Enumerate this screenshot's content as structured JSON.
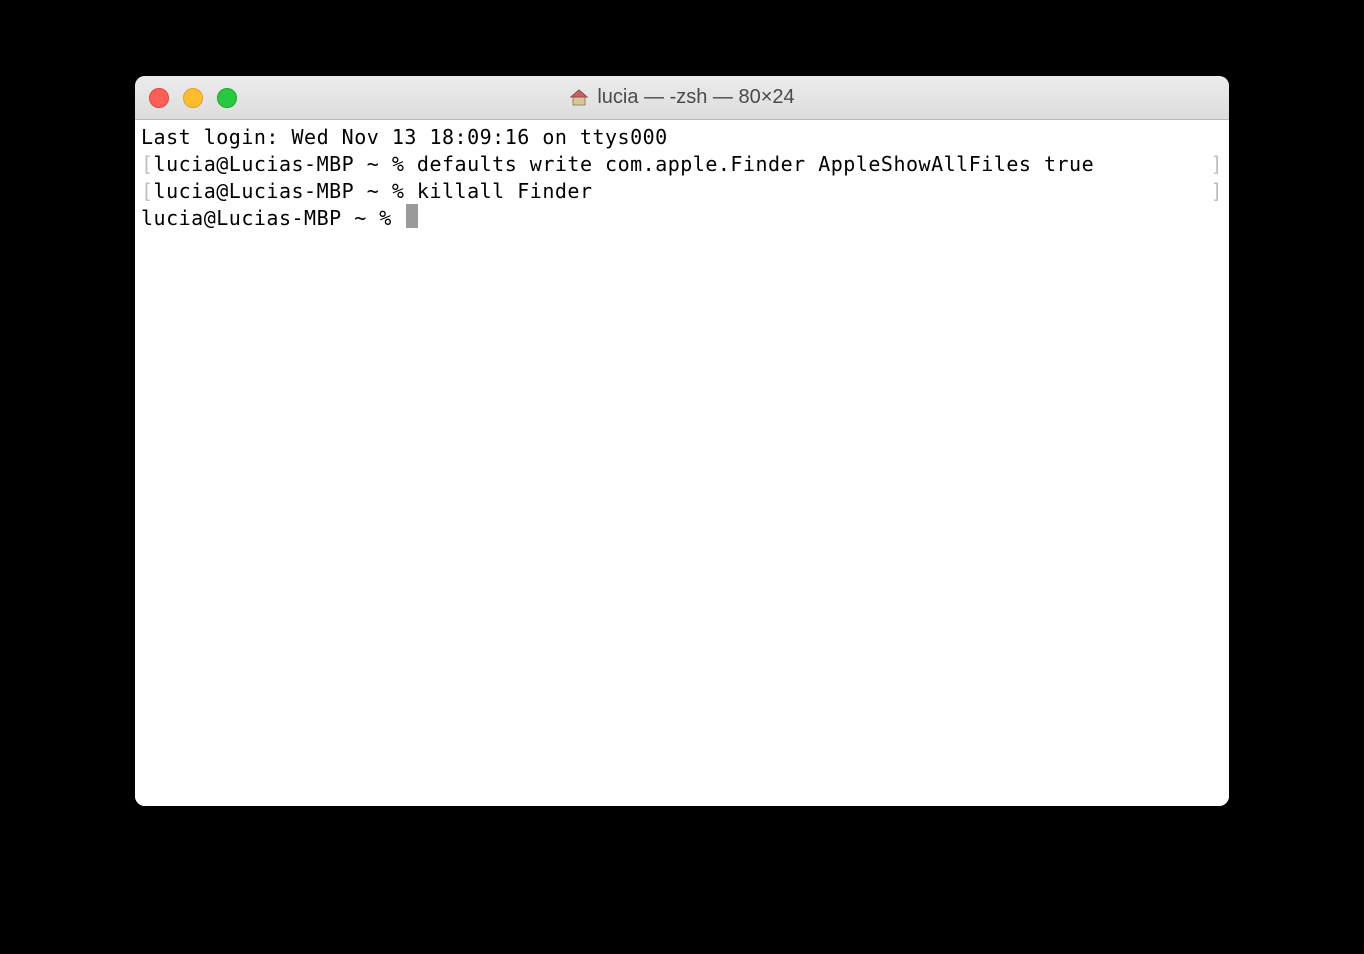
{
  "window": {
    "title": "lucia — -zsh — 80×24"
  },
  "terminal": {
    "lines": [
      {
        "leftBracket": "",
        "content": "Last login: Wed Nov 13 18:09:16 on ttys000",
        "rightBracket": ""
      },
      {
        "leftBracket": "[",
        "content": "lucia@Lucias-MBP ~ % defaults write com.apple.Finder AppleShowAllFiles true",
        "rightBracket": "]"
      },
      {
        "leftBracket": "[",
        "content": "lucia@Lucias-MBP ~ % killall Finder",
        "rightBracket": "]"
      },
      {
        "leftBracket": "",
        "content": "lucia@Lucias-MBP ~ % ",
        "rightBracket": ""
      }
    ]
  }
}
